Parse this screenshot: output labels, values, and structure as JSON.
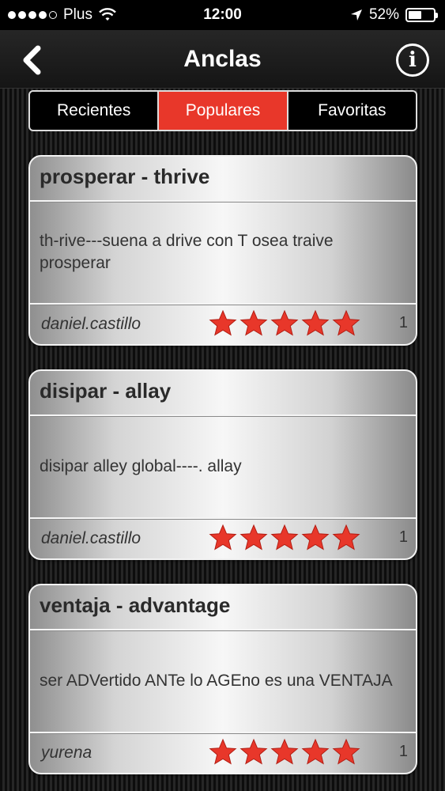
{
  "status_bar": {
    "carrier": "Plus",
    "time": "12:00",
    "battery": "52%",
    "battery_level": 0.52
  },
  "nav": {
    "title": "Anclas",
    "back_icon": "chevron-left-icon",
    "info_icon": "info-icon",
    "info_label": "i"
  },
  "tabs": [
    {
      "label": "Recientes",
      "active": false
    },
    {
      "label": "Populares",
      "active": true
    },
    {
      "label": "Favoritas",
      "active": false
    }
  ],
  "cards": [
    {
      "title": "prosperar - thrive",
      "body": "th-rive---suena a drive con T osea traive prosperar",
      "author": "daniel.castillo",
      "rating": 5,
      "count": "1"
    },
    {
      "title": "disipar - allay",
      "body": "disipar alley global----. allay",
      "author": "daniel.castillo",
      "rating": 5,
      "count": "1"
    },
    {
      "title": "ventaja - advantage",
      "body": "ser ADVertido ANTe lo AGEno es una VENTAJA",
      "author": "yurena",
      "rating": 5,
      "count": "1"
    }
  ],
  "colors": {
    "accent": "#e8372a",
    "star": "#e8372a"
  }
}
